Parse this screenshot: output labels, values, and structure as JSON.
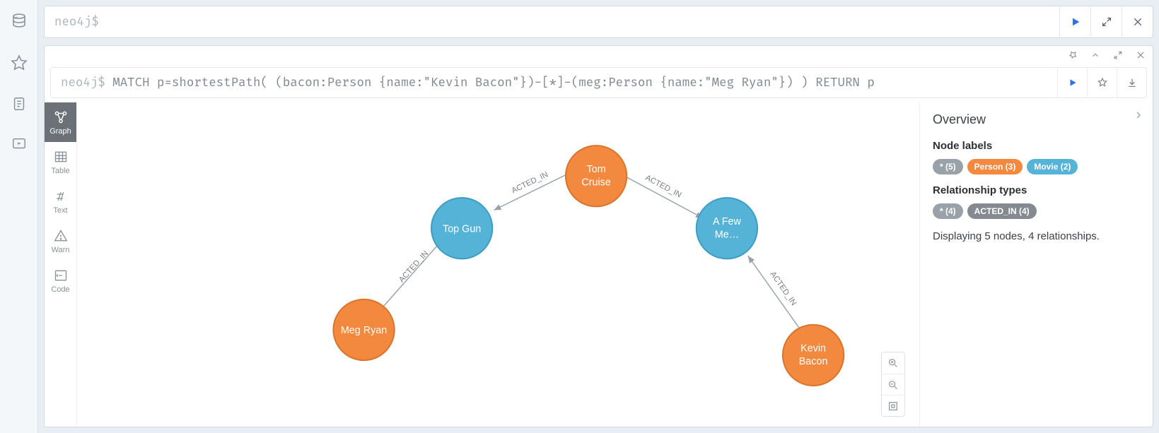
{
  "editor": {
    "prompt": "neo4j$"
  },
  "query": {
    "prompt": "neo4j$",
    "text": "MATCH p=shortestPath( (bacon:Person {name:\"Kevin Bacon\"})-[*]-(meg:Person {name:\"Meg Ryan\"}) ) RETURN p"
  },
  "view_tabs": {
    "graph": "Graph",
    "table": "Table",
    "text": "Text",
    "warn": "Warn",
    "code": "Code"
  },
  "graph": {
    "nodes": {
      "meg": {
        "line1": "Meg Ryan",
        "type": "person"
      },
      "topgun": {
        "line1": "Top Gun",
        "type": "movie"
      },
      "tom": {
        "line1": "Tom",
        "line2": "Cruise",
        "type": "person"
      },
      "fewgood": {
        "line1": "A Few",
        "line2": "Me…",
        "type": "movie"
      },
      "bacon": {
        "line1": "Kevin",
        "line2": "Bacon",
        "type": "person"
      }
    },
    "rel_label": "ACTED_IN"
  },
  "inspector": {
    "title": "Overview",
    "node_labels_heading": "Node labels",
    "rel_types_heading": "Relationship types",
    "labels": {
      "all": "* (5)",
      "person": "Person (3)",
      "movie": "Movie (2)"
    },
    "rels": {
      "all": "* (4)",
      "acted": "ACTED_IN (4)"
    },
    "summary": "Displaying 5 nodes, 4 relationships."
  }
}
